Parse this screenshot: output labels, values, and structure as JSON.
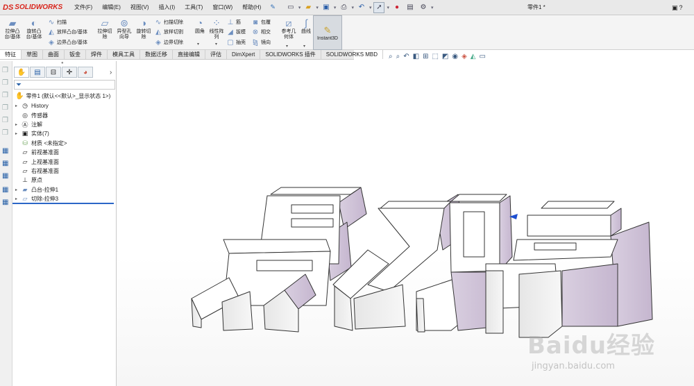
{
  "app": {
    "brand": "SOLIDWORKS",
    "brand_mark": "DS"
  },
  "menu": [
    "文件(F)",
    "编辑(E)",
    "视图(V)",
    "插入(I)",
    "工具(T)",
    "窗口(W)",
    "帮助(H)"
  ],
  "doc_title": "零件1 *",
  "commands": {
    "extrude_boss": "拉伸凸\n台/基体",
    "revolve_boss": "旋转凸\n台/基体",
    "sweep": "扫描",
    "loft_boss": "放样凸台/基体",
    "boundary_boss": "边界凸台/基体",
    "extrude_cut": "拉伸切\n除",
    "hole_wizard": "异型孔\n向导",
    "revolve_cut": "旋转切\n除",
    "sweep_cut": "扫描切除",
    "loft_cut": "放样切割",
    "boundary_cut": "边界切除",
    "fillet": "圆角",
    "linear_pattern": "线性阵\n列",
    "rib": "筋",
    "draft": "拔模",
    "shell": "抽壳",
    "wrap": "包覆",
    "intersect": "相交",
    "mirror": "镜向",
    "ref_geometry": "参考几\n何体",
    "curves": "曲线",
    "instant3d": "Instant3D"
  },
  "tabs": [
    "特征",
    "草图",
    "曲面",
    "钣金",
    "焊件",
    "模具工具",
    "数据迁移",
    "直接编辑",
    "评估",
    "DimXpert",
    "SOLIDWORKS 插件",
    "SOLIDWORKS MBD"
  ],
  "feature_tree": {
    "root": "零件1 (默认<<默认>_显示状态 1>)",
    "items": [
      {
        "label": "History",
        "toggle": "▸",
        "icon": "history-icon"
      },
      {
        "label": "传感器",
        "toggle": "",
        "icon": "sensor-icon"
      },
      {
        "label": "注解",
        "toggle": "▸",
        "icon": "annotation-icon"
      },
      {
        "label": "实体(7)",
        "toggle": "▸",
        "icon": "solid-bodies-icon"
      },
      {
        "label": "材质 <未指定>",
        "toggle": "",
        "icon": "material-icon"
      },
      {
        "label": "前视基准面",
        "toggle": "",
        "icon": "plane-icon"
      },
      {
        "label": "上视基准面",
        "toggle": "",
        "icon": "plane-icon"
      },
      {
        "label": "右视基准面",
        "toggle": "",
        "icon": "plane-icon"
      },
      {
        "label": "原点",
        "toggle": "",
        "icon": "origin-icon"
      },
      {
        "label": "凸台-拉伸1",
        "toggle": "▸",
        "icon": "boss-extrude-icon"
      },
      {
        "label": "切除-拉伸3",
        "toggle": "▸",
        "icon": "cut-extrude-icon"
      }
    ]
  },
  "watermark": {
    "main": "Baidu经验",
    "sub": "jingyan.baidu.com"
  }
}
